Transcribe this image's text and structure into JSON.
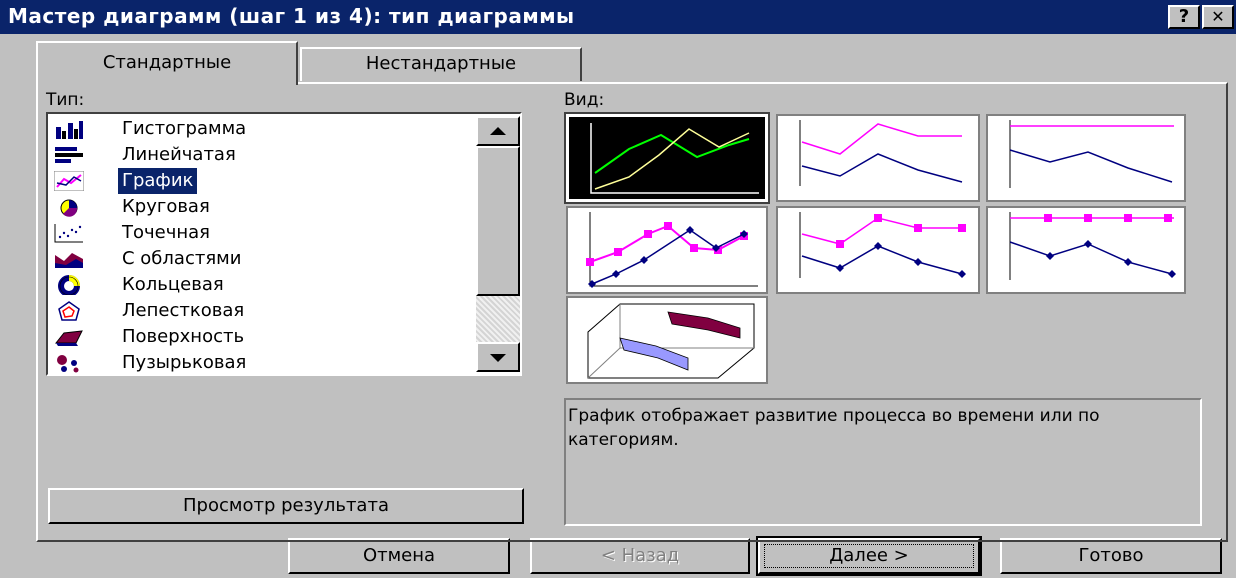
{
  "window": {
    "title": "Мастер диаграмм (шаг 1 из 4): тип диаграммы",
    "help_label": "?",
    "close_label": "✕"
  },
  "tabs": [
    {
      "label": "Стандартные",
      "active": true
    },
    {
      "label": "Нестандартные",
      "active": false
    }
  ],
  "type_list": {
    "label": "Тип:",
    "selected": "График",
    "items": [
      {
        "label": "Гистограмма",
        "icon": "column-chart-icon"
      },
      {
        "label": "Линейчатая",
        "icon": "bar-chart-icon"
      },
      {
        "label": "График",
        "icon": "line-chart-icon"
      },
      {
        "label": "Круговая",
        "icon": "pie-chart-icon"
      },
      {
        "label": "Точечная",
        "icon": "scatter-chart-icon"
      },
      {
        "label": "С областями",
        "icon": "area-chart-icon"
      },
      {
        "label": "Кольцевая",
        "icon": "doughnut-chart-icon"
      },
      {
        "label": "Лепестковая",
        "icon": "radar-chart-icon"
      },
      {
        "label": "Поверхность",
        "icon": "surface-chart-icon"
      },
      {
        "label": "Пузырьковая",
        "icon": "bubble-chart-icon"
      }
    ]
  },
  "subtype": {
    "label": "Вид:",
    "selected_index": 0,
    "count": 7
  },
  "description": "График отображает развитие процесса во времени или по категориям.",
  "buttons": {
    "preview": "Просмотр результата",
    "cancel": "Отмена",
    "back": "< Назад",
    "next": "Далее >",
    "finish": "Готово"
  },
  "colors": {
    "title_bar": "#0a246a",
    "face": "#c0c0c0",
    "selection": "#0a246a",
    "magenta": "#ff00ff",
    "navy": "#000080"
  }
}
